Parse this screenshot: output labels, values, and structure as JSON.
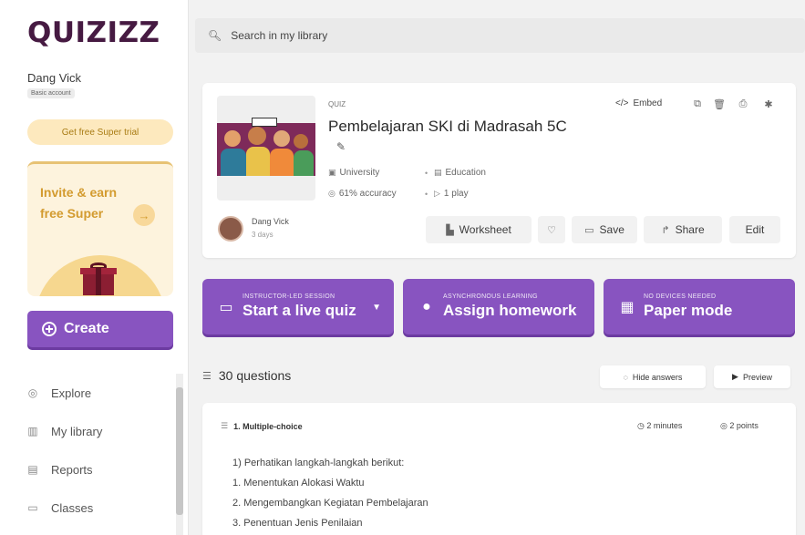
{
  "app": {
    "logo": "QUIZIZZ"
  },
  "user": {
    "name": "Dang Vick",
    "account_type": "Basic account"
  },
  "sidebar": {
    "trial_label": "Get free Super trial",
    "invite_line1": "Invite & earn",
    "invite_line2": "free Super",
    "create_label": "Create",
    "nav": [
      {
        "label": "Explore",
        "icon": "compass-icon"
      },
      {
        "label": "My library",
        "icon": "library-icon"
      },
      {
        "label": "Reports",
        "icon": "reports-icon"
      },
      {
        "label": "Classes",
        "icon": "classes-icon"
      }
    ]
  },
  "search": {
    "placeholder": "Search in my library"
  },
  "quiz": {
    "type": "QUIZ",
    "title": "Pembelajaran SKI di Madrasah 5C",
    "level": "University",
    "subject": "Education",
    "accuracy": "61% accuracy",
    "plays": "1 play",
    "embed_label": "Embed",
    "author": "Dang Vick",
    "author_date": "3 days",
    "worksheet_label": "Worksheet",
    "save_label": "Save",
    "share_label": "Share",
    "edit_label": "Edit"
  },
  "cta": [
    {
      "sub": "INSTRUCTOR-LED SESSION",
      "main": "Start a live quiz"
    },
    {
      "sub": "ASYNCHRONOUS LEARNING",
      "main": "Assign homework"
    },
    {
      "sub": "NO DEVICES NEEDED",
      "main": "Paper mode"
    }
  ],
  "questions": {
    "count_label": "30 questions",
    "hide_label": "Hide answers",
    "preview_label": "Preview",
    "first": {
      "type_label": "1. Multiple-choice",
      "time": "2 minutes",
      "points": "2 points",
      "lines": [
        "1) Perhatikan langkah-langkah berikut:",
        "1. Menentukan Alokasi Waktu",
        "2. Mengembangkan Kegiatan Pembelajaran",
        "3. Penentuan Jenis Penilaian"
      ]
    }
  },
  "colors": {
    "brand_purple": "#8854c0",
    "logo": "#461a42",
    "trial_bg": "#fde9be",
    "invite_text": "#d39b2f"
  }
}
